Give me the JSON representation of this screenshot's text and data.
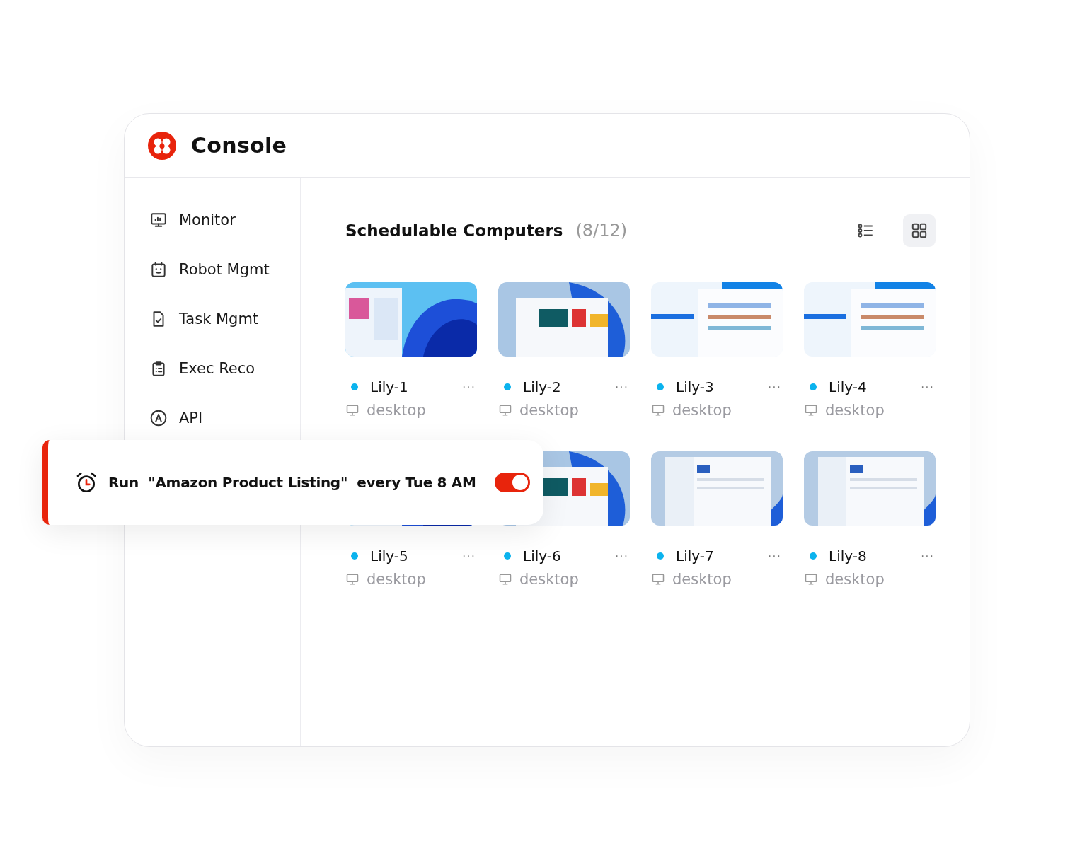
{
  "header": {
    "title": "Console"
  },
  "sidebar": {
    "items": [
      {
        "label": "Monitor",
        "kind": "monitor"
      },
      {
        "label": "Robot Mgmt",
        "kind": "robot"
      },
      {
        "label": "Task Mgmt",
        "kind": "task"
      },
      {
        "label": "Exec Reco",
        "kind": "record"
      },
      {
        "label": "API",
        "kind": "api"
      }
    ]
  },
  "main": {
    "title": "Schedulable Computers",
    "count": "(8/12)",
    "views": [
      {
        "kind": "list",
        "selected": false
      },
      {
        "kind": "grid",
        "selected": true
      }
    ],
    "computers": [
      {
        "name": "Lily-1",
        "type": "desktop",
        "menu": "···"
      },
      {
        "name": "Lily-2",
        "type": "desktop",
        "menu": "···"
      },
      {
        "name": "Lily-3",
        "type": "desktop",
        "menu": "···"
      },
      {
        "name": "Lily-4",
        "type": "desktop",
        "menu": "···"
      },
      {
        "name": "Lily-5",
        "type": "desktop",
        "menu": "···"
      },
      {
        "name": "Lily-6",
        "type": "desktop",
        "menu": "···"
      },
      {
        "name": "Lily-7",
        "type": "desktop",
        "menu": "···"
      },
      {
        "name": "Lily-8",
        "type": "desktop",
        "menu": "···"
      }
    ]
  },
  "schedule_toast": {
    "text": "Run  \"Amazon Product Listing\"  every Tue 8 AM",
    "on": true
  }
}
